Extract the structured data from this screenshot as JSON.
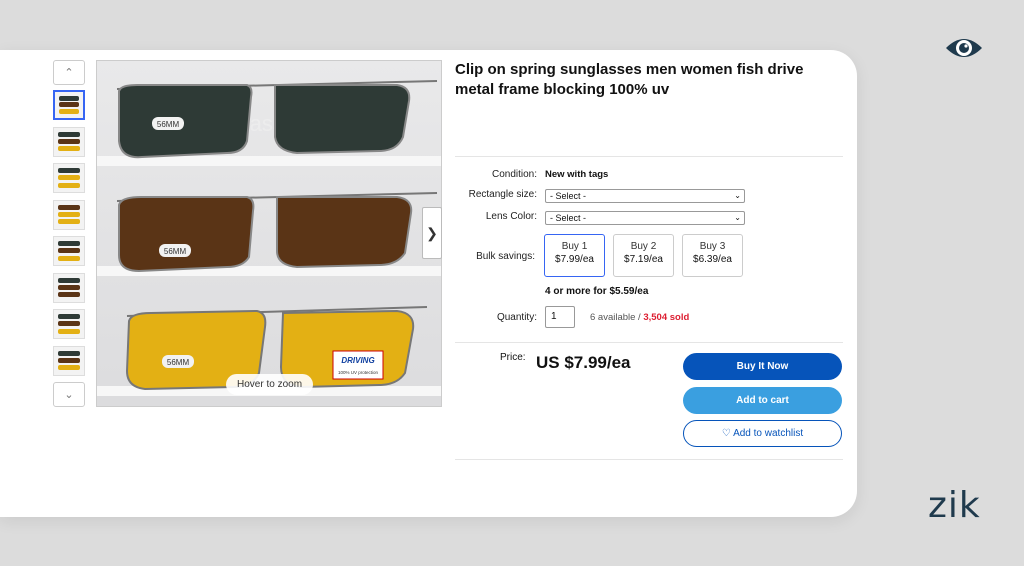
{
  "product": {
    "title": "Clip on spring sunglasses men women fish drive metal frame blocking 100% uv",
    "condition_label": "Condition:",
    "condition_value": "New with tags",
    "rect_label": "Rectangle size:",
    "rect_value": "- Select -",
    "lens_label": "Lens Color:",
    "lens_value": "- Select -",
    "bulk_label": "Bulk savings:",
    "bulk_options": [
      {
        "title": "Buy 1",
        "price": "$7.99/ea"
      },
      {
        "title": "Buy 2",
        "price": "$7.19/ea"
      },
      {
        "title": "Buy 3",
        "price": "$6.39/ea"
      }
    ],
    "bulk_more": "4 or more for $5.59/ea",
    "qty_label": "Quantity:",
    "qty_value": "1",
    "available_text": "6 available / ",
    "sold_text": "3,504 sold",
    "price_label": "Price:",
    "price": "US $7.99/ea"
  },
  "actions": {
    "buy_now": "Buy It Now",
    "add_cart": "Add to cart",
    "watchlist": "♡ Add to watchlist"
  },
  "gallery": {
    "zoom_hint": "Hover to zoom",
    "label_text": "56MM",
    "watermark": "sunglasses",
    "brand_text": "DRIVING",
    "brand_sub": "100% UV protection",
    "thumb_count": 8
  },
  "branding": {
    "wordmark": "zik"
  },
  "colors": {
    "accent": "#3665f3",
    "buy_now": "#0654ba",
    "add_cart": "#3a9fe0",
    "sold": "#dd1e31",
    "lens_gray": "#2e3a36",
    "lens_brown": "#5a3416",
    "lens_yellow": "#e3b014"
  },
  "icons": {
    "eye": "eye-icon",
    "up": "chevron-up-icon",
    "down": "chevron-down-icon",
    "next": "chevron-right-icon"
  }
}
